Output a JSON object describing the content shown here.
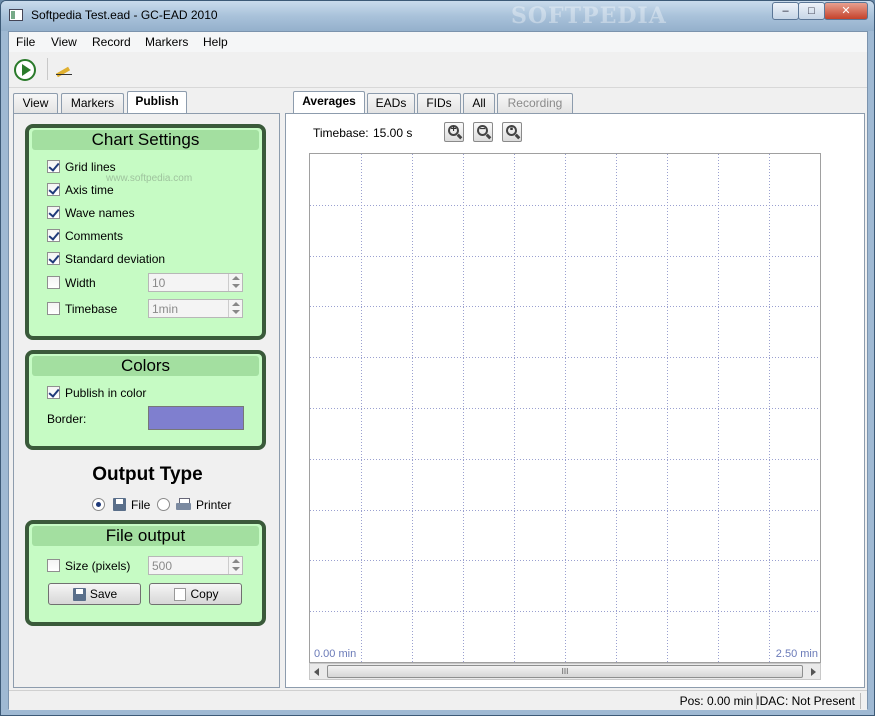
{
  "window": {
    "title": "Softpedia Test.ead - GC-EAD 2010",
    "watermark": "SOFTPEDIA",
    "min_glyph": "–",
    "max_glyph": "□",
    "close_glyph": "✕"
  },
  "menu": [
    "File",
    "View",
    "Record",
    "Markers",
    "Help"
  ],
  "left_tabs": [
    {
      "label": "View",
      "active": false
    },
    {
      "label": "Markers",
      "active": false
    },
    {
      "label": "Publish",
      "active": true
    }
  ],
  "chart_settings": {
    "title": "Chart Settings",
    "watermark": "www.softpedia.com",
    "options": [
      {
        "label": "Grid lines",
        "checked": true
      },
      {
        "label": "Axis time",
        "checked": true
      },
      {
        "label": "Wave names",
        "checked": true
      },
      {
        "label": "Comments",
        "checked": true
      },
      {
        "label": "Standard deviation",
        "checked": true
      }
    ],
    "width": {
      "label": "Width",
      "checked": false,
      "value": "10"
    },
    "timebase": {
      "label": "Timebase",
      "checked": false,
      "value": "1min"
    }
  },
  "colors": {
    "title": "Colors",
    "publish_in_color": {
      "label": "Publish in color",
      "checked": true
    },
    "border_label": "Border:",
    "border_color": "#7f7fcf"
  },
  "output_type": {
    "title": "Output Type",
    "file_label": "File",
    "printer_label": "Printer",
    "selected": "File"
  },
  "file_output": {
    "title": "File output",
    "size": {
      "label": "Size (pixels)",
      "checked": false,
      "value": "500"
    },
    "save_label": "Save",
    "copy_label": "Copy"
  },
  "right_tabs": [
    {
      "label": "Averages",
      "active": true
    },
    {
      "label": "EADs",
      "active": false
    },
    {
      "label": "FIDs",
      "active": false
    },
    {
      "label": "All",
      "active": false
    },
    {
      "label": "Recording",
      "active": false,
      "disabled": true
    }
  ],
  "chart": {
    "timebase_label": "Timebase:",
    "timebase_value": "15.00 s",
    "axis_start": "0.00 min",
    "axis_end": "2.50 min",
    "scroll_grip": "III"
  },
  "status": {
    "pos": "Pos: 0.00 min",
    "idac": "IDAC: Not Present"
  },
  "chart_data": {
    "type": "line",
    "x_label_start": "0.00 min",
    "x_label_end": "2.50 min",
    "xlim": [
      0,
      2.5
    ],
    "grid": true,
    "grid_cols": 10,
    "grid_rows": 10,
    "series": []
  }
}
